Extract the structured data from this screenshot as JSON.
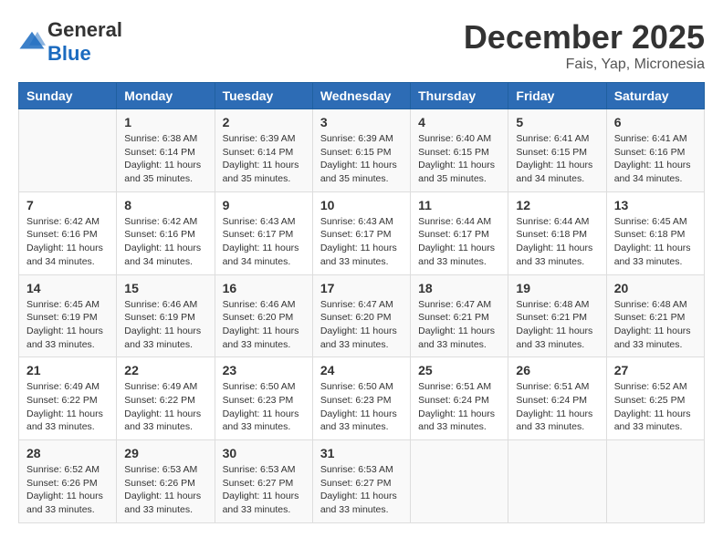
{
  "header": {
    "logo": {
      "general": "General",
      "blue": "Blue"
    },
    "title": "December 2025",
    "location": "Fais, Yap, Micronesia"
  },
  "calendar": {
    "days_of_week": [
      "Sunday",
      "Monday",
      "Tuesday",
      "Wednesday",
      "Thursday",
      "Friday",
      "Saturday"
    ],
    "weeks": [
      [
        {
          "day": "",
          "info": ""
        },
        {
          "day": "1",
          "info": "Sunrise: 6:38 AM\nSunset: 6:14 PM\nDaylight: 11 hours and 35 minutes."
        },
        {
          "day": "2",
          "info": "Sunrise: 6:39 AM\nSunset: 6:14 PM\nDaylight: 11 hours and 35 minutes."
        },
        {
          "day": "3",
          "info": "Sunrise: 6:39 AM\nSunset: 6:15 PM\nDaylight: 11 hours and 35 minutes."
        },
        {
          "day": "4",
          "info": "Sunrise: 6:40 AM\nSunset: 6:15 PM\nDaylight: 11 hours and 35 minutes."
        },
        {
          "day": "5",
          "info": "Sunrise: 6:41 AM\nSunset: 6:15 PM\nDaylight: 11 hours and 34 minutes."
        },
        {
          "day": "6",
          "info": "Sunrise: 6:41 AM\nSunset: 6:16 PM\nDaylight: 11 hours and 34 minutes."
        }
      ],
      [
        {
          "day": "7",
          "info": "Sunrise: 6:42 AM\nSunset: 6:16 PM\nDaylight: 11 hours and 34 minutes."
        },
        {
          "day": "8",
          "info": "Sunrise: 6:42 AM\nSunset: 6:16 PM\nDaylight: 11 hours and 34 minutes."
        },
        {
          "day": "9",
          "info": "Sunrise: 6:43 AM\nSunset: 6:17 PM\nDaylight: 11 hours and 34 minutes."
        },
        {
          "day": "10",
          "info": "Sunrise: 6:43 AM\nSunset: 6:17 PM\nDaylight: 11 hours and 33 minutes."
        },
        {
          "day": "11",
          "info": "Sunrise: 6:44 AM\nSunset: 6:17 PM\nDaylight: 11 hours and 33 minutes."
        },
        {
          "day": "12",
          "info": "Sunrise: 6:44 AM\nSunset: 6:18 PM\nDaylight: 11 hours and 33 minutes."
        },
        {
          "day": "13",
          "info": "Sunrise: 6:45 AM\nSunset: 6:18 PM\nDaylight: 11 hours and 33 minutes."
        }
      ],
      [
        {
          "day": "14",
          "info": "Sunrise: 6:45 AM\nSunset: 6:19 PM\nDaylight: 11 hours and 33 minutes."
        },
        {
          "day": "15",
          "info": "Sunrise: 6:46 AM\nSunset: 6:19 PM\nDaylight: 11 hours and 33 minutes."
        },
        {
          "day": "16",
          "info": "Sunrise: 6:46 AM\nSunset: 6:20 PM\nDaylight: 11 hours and 33 minutes."
        },
        {
          "day": "17",
          "info": "Sunrise: 6:47 AM\nSunset: 6:20 PM\nDaylight: 11 hours and 33 minutes."
        },
        {
          "day": "18",
          "info": "Sunrise: 6:47 AM\nSunset: 6:21 PM\nDaylight: 11 hours and 33 minutes."
        },
        {
          "day": "19",
          "info": "Sunrise: 6:48 AM\nSunset: 6:21 PM\nDaylight: 11 hours and 33 minutes."
        },
        {
          "day": "20",
          "info": "Sunrise: 6:48 AM\nSunset: 6:21 PM\nDaylight: 11 hours and 33 minutes."
        }
      ],
      [
        {
          "day": "21",
          "info": "Sunrise: 6:49 AM\nSunset: 6:22 PM\nDaylight: 11 hours and 33 minutes."
        },
        {
          "day": "22",
          "info": "Sunrise: 6:49 AM\nSunset: 6:22 PM\nDaylight: 11 hours and 33 minutes."
        },
        {
          "day": "23",
          "info": "Sunrise: 6:50 AM\nSunset: 6:23 PM\nDaylight: 11 hours and 33 minutes."
        },
        {
          "day": "24",
          "info": "Sunrise: 6:50 AM\nSunset: 6:23 PM\nDaylight: 11 hours and 33 minutes."
        },
        {
          "day": "25",
          "info": "Sunrise: 6:51 AM\nSunset: 6:24 PM\nDaylight: 11 hours and 33 minutes."
        },
        {
          "day": "26",
          "info": "Sunrise: 6:51 AM\nSunset: 6:24 PM\nDaylight: 11 hours and 33 minutes."
        },
        {
          "day": "27",
          "info": "Sunrise: 6:52 AM\nSunset: 6:25 PM\nDaylight: 11 hours and 33 minutes."
        }
      ],
      [
        {
          "day": "28",
          "info": "Sunrise: 6:52 AM\nSunset: 6:26 PM\nDaylight: 11 hours and 33 minutes."
        },
        {
          "day": "29",
          "info": "Sunrise: 6:53 AM\nSunset: 6:26 PM\nDaylight: 11 hours and 33 minutes."
        },
        {
          "day": "30",
          "info": "Sunrise: 6:53 AM\nSunset: 6:27 PM\nDaylight: 11 hours and 33 minutes."
        },
        {
          "day": "31",
          "info": "Sunrise: 6:53 AM\nSunset: 6:27 PM\nDaylight: 11 hours and 33 minutes."
        },
        {
          "day": "",
          "info": ""
        },
        {
          "day": "",
          "info": ""
        },
        {
          "day": "",
          "info": ""
        }
      ]
    ]
  }
}
